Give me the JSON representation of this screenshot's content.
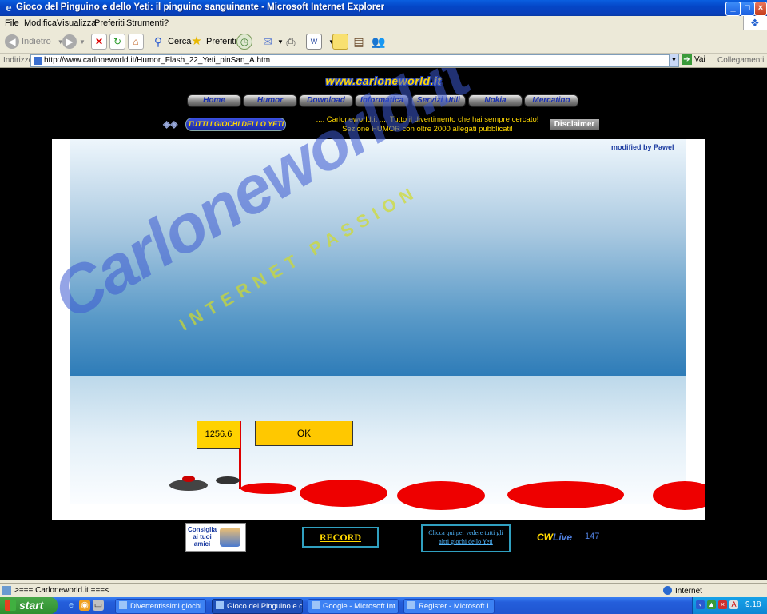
{
  "window": {
    "title": "Gioco del Pinguino e dello Yeti: il pinguino sanguinante - Microsoft Internet Explorer"
  },
  "menu": [
    "File",
    "Modifica",
    "Visualizza",
    "Preferiti",
    "Strumenti",
    "?"
  ],
  "toolbar": {
    "back_label": "Indietro",
    "search_label": "Cerca",
    "favorites_label": "Preferiti"
  },
  "address": {
    "label": "Indirizzo",
    "url": "http://www.carloneworld.it/Humor_Flash_22_Yeti_pinSan_A.htm",
    "go_label": "Vai",
    "links_label": "Collegamenti"
  },
  "site": {
    "logo_text": "www.carloneworld.it",
    "nav": [
      "Home",
      "Humor",
      "Download",
      "Informatica",
      "Servizi Utili",
      "Nokia",
      "Mercatino"
    ],
    "tutti_label": "TUTTI I GIOCHI DELLO YETI",
    "promo_line1": "..:: Carloneworld.it ::.. Tutto il divertimento che hai sempre cercato!",
    "promo_line2": "Sezione HUMOR con oltre 2000 allegati pubblicati!",
    "disclaimer_label": "Disclaimer",
    "watermark": "Carloneworld.it",
    "watermark_tagline": "INTERNET PASSION"
  },
  "game": {
    "modified_by": "modified by Pawel",
    "score": "1256.6",
    "ok_label": "OK",
    "colors": {
      "sky_top": "#eef6fc",
      "sky_bottom": "#2e7cb8",
      "box": "#ffd200",
      "blood": "#e00000"
    }
  },
  "footer": {
    "consiglia_label": "Consiglia ai tuoi amici",
    "record_label": "RECORD",
    "clicca_label": "Clicca qui per vedere tutti gli altri giochi dello Yeti",
    "cwlive_cw": "CW",
    "cwlive_live": "Live",
    "cwlive_count": "147"
  },
  "status": {
    "text": ">=== Carloneworld.it ===<",
    "zone": "Internet"
  },
  "taskbar": {
    "start_label": "start",
    "tasks": [
      "Divertentissimi giochi ...",
      "Gioco del Pinguino e d...",
      "Google - Microsoft Int...",
      "Register - Microsoft I..."
    ],
    "clock": "9.18"
  }
}
